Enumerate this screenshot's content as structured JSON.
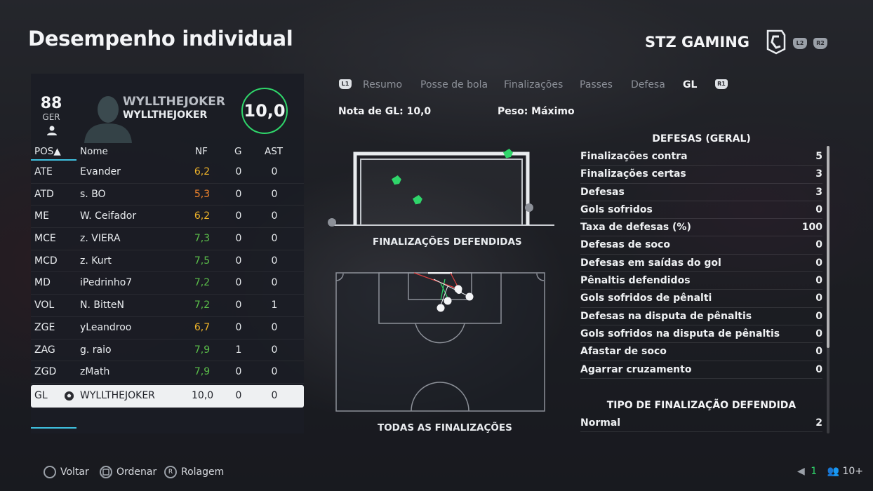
{
  "page_title": "Desempenho individual",
  "club_name": "STZ GAMING",
  "shoulder_left": "L2",
  "shoulder_right": "R2",
  "player": {
    "overall": "88",
    "position": "GER",
    "name_primary": "WYLLTHEJOKER",
    "name_secondary": "WYLLTHEJOKER",
    "match_rating": "10,0"
  },
  "table": {
    "headers": {
      "pos": "POS▲",
      "name": "Nome",
      "nf": "NF",
      "g": "G",
      "ast": "AST"
    },
    "rows": [
      {
        "pos": "ATE",
        "name": "Evander",
        "nf": "6,2",
        "g": "0",
        "ast": "0",
        "nf_color": "#f0b429"
      },
      {
        "pos": "ATD",
        "name": "s. BO",
        "nf": "5,3",
        "g": "0",
        "ast": "0",
        "nf_color": "#f0842c"
      },
      {
        "pos": "ME",
        "name": "W. Ceifador",
        "nf": "6,2",
        "g": "0",
        "ast": "0",
        "nf_color": "#f0b429"
      },
      {
        "pos": "MCE",
        "name": "z. VIERA",
        "nf": "7,3",
        "g": "0",
        "ast": "0",
        "nf_color": "#5bbf4a"
      },
      {
        "pos": "MCD",
        "name": "z. Kurt",
        "nf": "7,5",
        "g": "0",
        "ast": "0",
        "nf_color": "#5bbf4a"
      },
      {
        "pos": "MD",
        "name": "iPedrinho7",
        "nf": "7,2",
        "g": "0",
        "ast": "0",
        "nf_color": "#5bbf4a"
      },
      {
        "pos": "VOL",
        "name": "N. BitteN",
        "nf": "7,2",
        "g": "0",
        "ast": "1",
        "nf_color": "#5bbf4a"
      },
      {
        "pos": "ZGE",
        "name": "yLeandroo",
        "nf": "6,7",
        "g": "0",
        "ast": "0",
        "nf_color": "#f0b429"
      },
      {
        "pos": "ZAG",
        "name": "g. raio",
        "nf": "7,9",
        "g": "1",
        "ast": "0",
        "nf_color": "#5bbf4a"
      },
      {
        "pos": "ZGD",
        "name": "zMath",
        "nf": "7,9",
        "g": "0",
        "ast": "0",
        "nf_color": "#5bbf4a"
      }
    ],
    "selected_row": {
      "pos": "GL",
      "name": "WYLLTHEJOKER",
      "nf": "10,0",
      "g": "0",
      "ast": "0",
      "icon": "soccer-ball-icon"
    }
  },
  "tabs": {
    "left_bumper": "L1",
    "right_bumper": "R1",
    "items": [
      "Resumo",
      "Posse de bola",
      "Finalizações",
      "Passes",
      "Defesa",
      "GL"
    ],
    "active": "GL"
  },
  "meta": {
    "gk_rating": "Nota de GL: 10,0",
    "weight": "Peso: Máximo"
  },
  "diagrams": {
    "goal_label": "FINALIZAÇÕES DEFENDIDAS",
    "field_label": "TODAS AS FINALIZAÇÕES"
  },
  "stats": {
    "section1_title": "DEFESAS (GERAL)",
    "section1": [
      {
        "label": "Finalizações contra",
        "value": "5"
      },
      {
        "label": "Finalizações certas",
        "value": "3"
      },
      {
        "label": "Defesas",
        "value": "3"
      },
      {
        "label": "Gols sofridos",
        "value": "0"
      },
      {
        "label": "Taxa de defesas (%)",
        "value": "100"
      },
      {
        "label": "Defesas de soco",
        "value": "0"
      },
      {
        "label": "Defesas em saídas do gol",
        "value": "0"
      },
      {
        "label": "Pênaltis defendidos",
        "value": "0"
      },
      {
        "label": "Gols sofridos de pênalti",
        "value": "0"
      },
      {
        "label": "Defesas na disputa de pênaltis",
        "value": "0"
      },
      {
        "label": "Gols sofridos na disputa de pênaltis",
        "value": "0"
      },
      {
        "label": "Afastar de soco",
        "value": "0"
      },
      {
        "label": "Agarrar cruzamento",
        "value": "0"
      }
    ],
    "section2_title": "TIPO DE FINALIZAÇÃO DEFENDIDA",
    "section2": [
      {
        "label": "Normal",
        "value": "2"
      }
    ]
  },
  "footer": {
    "back": "Voltar",
    "sort": "Ordenar",
    "scroll": "Rolagem",
    "scroll_button": "R",
    "count": "1",
    "players": "10+"
  },
  "colors": {
    "accent_cyan": "#3fc1e0",
    "rating_green": "#2fd56a",
    "save_marker": "#2fd56a"
  }
}
